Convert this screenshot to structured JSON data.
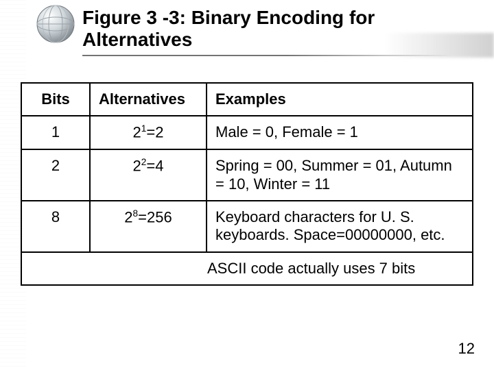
{
  "title": {
    "line1": "Figure 3 -3: Binary Encoding for",
    "line2": "Alternatives"
  },
  "headers": {
    "bits": "Bits",
    "alternatives": "Alternatives",
    "examples": "Examples"
  },
  "rows": [
    {
      "bits": "1",
      "alt_base": "2",
      "alt_exp": "1",
      "alt_result": "=2",
      "example": "Male = 0, Female = 1"
    },
    {
      "bits": "2",
      "alt_base": "2",
      "alt_exp": "2",
      "alt_result": "=4",
      "example": "Spring = 00, Summer = 01, Autumn = 10, Winter = 11"
    },
    {
      "bits": "8",
      "alt_base": "2",
      "alt_exp": "8",
      "alt_result": "=256",
      "example": "Keyboard characters for U. S. keyboards. Space=00000000, etc."
    }
  ],
  "footnote": "ASCII code actually uses 7 bits",
  "page_number": "12",
  "chart_data": {
    "type": "table",
    "title": "Figure 3-3: Binary Encoding for Alternatives",
    "columns": [
      "Bits",
      "Alternatives",
      "Examples"
    ],
    "rows": [
      [
        "1",
        "2^1=2",
        "Male = 0, Female = 1"
      ],
      [
        "2",
        "2^2=4",
        "Spring = 00, Summer = 01, Autumn = 10, Winter = 11"
      ],
      [
        "8",
        "2^8=256",
        "Keyboard characters for U. S. keyboards. Space=00000000, etc."
      ]
    ],
    "footnote": "ASCII code actually uses 7 bits"
  }
}
